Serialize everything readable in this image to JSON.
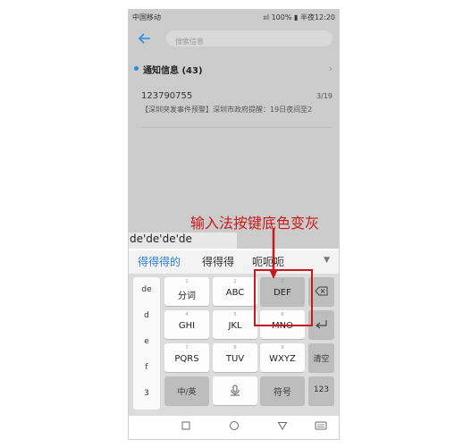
{
  "status": {
    "carrier": "中国移动",
    "right": "²ᴳıll 100% ▮ 半夜12:20"
  },
  "search": {
    "placeholder": "搜索信息"
  },
  "section": {
    "title": "通知信息 (43)"
  },
  "message": {
    "number": "123790755",
    "date": "3/19",
    "preview": "【深圳突发事件预警】深圳市政府提醒：19日夜间至2"
  },
  "annotation": "输入法按键底色变灰",
  "ime": {
    "composition": "de'de'de'de",
    "candidates": [
      "得得得的",
      "得得得",
      "呃呃呃"
    ],
    "left_column": [
      "de",
      "d",
      "e",
      "f",
      "3"
    ],
    "keys": [
      {
        "num": "1",
        "label": "分词"
      },
      {
        "num": "2",
        "label": "ABC"
      },
      {
        "num": "3",
        "label": "DEF"
      },
      {
        "num": "4",
        "label": "GHI"
      },
      {
        "num": "5",
        "label": "JKL"
      },
      {
        "num": "6",
        "label": "MNO"
      },
      {
        "num": "7",
        "label": "PQRS"
      },
      {
        "num": "8",
        "label": "TUV"
      },
      {
        "num": "9",
        "label": "WXYZ"
      }
    ],
    "clear_label": "清空",
    "mode_label": "中/英",
    "symbol_label": "符号",
    "num_label": "123"
  },
  "colors": {
    "accent": "#2a8de2",
    "annotation": "#c8191b"
  }
}
